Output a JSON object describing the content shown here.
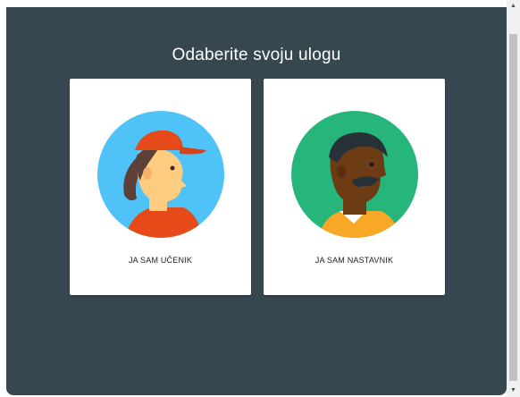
{
  "dialog": {
    "title": "Odaberite svoju ulogu"
  },
  "roles": [
    {
      "label": "JA SAM UČENIK",
      "avatar_icon": "student-avatar-icon"
    },
    {
      "label": "JA SAM NASTAVNIK",
      "avatar_icon": "teacher-avatar-icon"
    }
  ],
  "scrollbar": {
    "up_glyph": "▲",
    "down_glyph": "▼"
  },
  "colors": {
    "dialog_bg": "#37474f",
    "student_circle": "#4fc3f7",
    "student_cap": "#e64a19",
    "teacher_circle": "#26b57a",
    "teacher_shirt": "#f9a825"
  }
}
